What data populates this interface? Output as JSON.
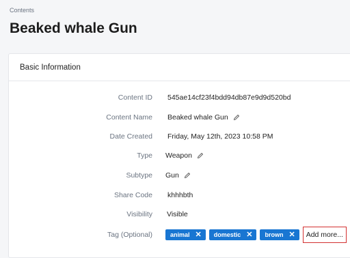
{
  "breadcrumb": "Contents",
  "page_title": "Beaked whale Gun",
  "card": {
    "title": "Basic Information",
    "fields": {
      "content_id": {
        "label": "Content ID",
        "value": "545ae14cf23f4bdd94db87e9d9d520bd"
      },
      "content_name": {
        "label": "Content Name",
        "value": "Beaked whale Gun"
      },
      "date_created": {
        "label": "Date Created",
        "value": "Friday, May 12th, 2023 10:58 PM"
      },
      "type": {
        "label": "Type",
        "value": "Weapon"
      },
      "subtype": {
        "label": "Subtype",
        "value": "Gun"
      },
      "share_code": {
        "label": "Share Code",
        "value": "khhhbth"
      },
      "visibility": {
        "label": "Visibility",
        "value": "Visible"
      },
      "tags": {
        "label": "Tag (Optional)",
        "items": [
          "animal",
          "domestic",
          "brown"
        ],
        "remove_glyph": "✕",
        "add_more": "Add more..."
      }
    }
  },
  "colors": {
    "tag_bg": "#1976d2",
    "highlight_border": "#d32f2f"
  },
  "icons": {
    "edit": "pencil-icon",
    "remove": "close-icon"
  }
}
